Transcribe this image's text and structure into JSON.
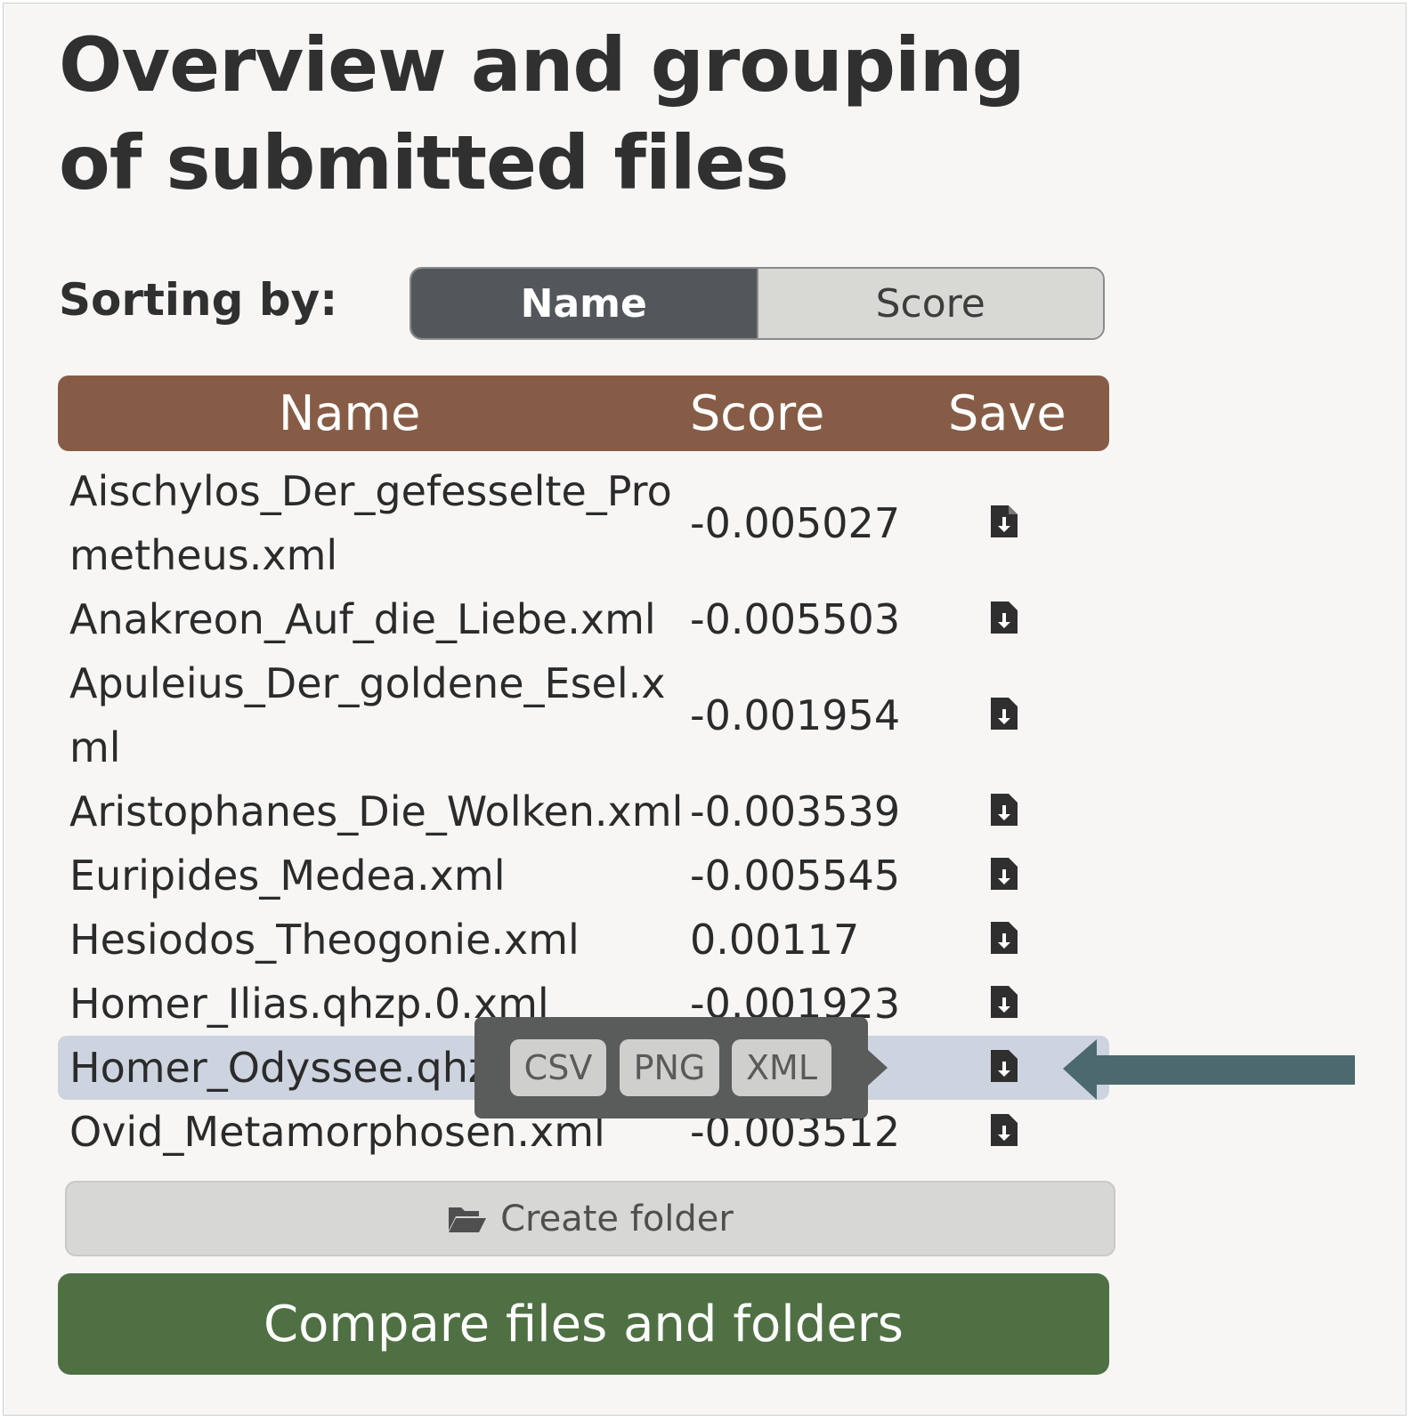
{
  "page": {
    "title": "Overview and grouping of submitted files"
  },
  "sorting": {
    "label": "Sorting by:",
    "options": [
      "Name",
      "Score"
    ],
    "selected": "Name"
  },
  "table": {
    "headers": {
      "name": "Name",
      "score": "Score",
      "save": "Save"
    },
    "rows": [
      {
        "name": "Aischylos_Der_gefesselte_Prometheus.xml",
        "score": "-0.005027",
        "save_icon": "file-download-icon"
      },
      {
        "name": "Anakreon_Auf_die_Liebe.xml",
        "score": "-0.005503",
        "save_icon": "file-download-icon"
      },
      {
        "name": "Apuleius_Der_goldene_Esel.xml",
        "score": "-0.001954",
        "save_icon": "file-download-icon"
      },
      {
        "name": "Aristophanes_Die_Wolken.xml",
        "score": "-0.003539",
        "save_icon": "file-download-icon"
      },
      {
        "name": "Euripides_Medea.xml",
        "score": "-0.005545",
        "save_icon": "file-download-icon"
      },
      {
        "name": "Hesiodos_Theogonie.xml",
        "score": "0.00117",
        "save_icon": "file-download-icon"
      },
      {
        "name": "Homer_Ilias.qhzp.0.xml",
        "score": "-0.001923",
        "save_icon": "file-download-icon"
      },
      {
        "name": "Homer_Odyssee.qhz",
        "score": "",
        "save_icon": "file-download-icon",
        "selected": true
      },
      {
        "name": "Ovid_Metamorphosen.xml",
        "score": "-0.003512",
        "save_icon": "file-download-icon"
      }
    ]
  },
  "export_popover": {
    "options": [
      "CSV",
      "PNG",
      "XML"
    ]
  },
  "actions": {
    "create_folder": "Create folder",
    "create_folder_icon": "folder-open-icon",
    "compare": "Compare files and folders"
  },
  "colors": {
    "header_brown": "#875c46",
    "toggle_active": "#53575b",
    "compare_green": "#4f7043",
    "selected_row": "#cdd4df",
    "pointer_arrow": "#4c6a6e"
  }
}
